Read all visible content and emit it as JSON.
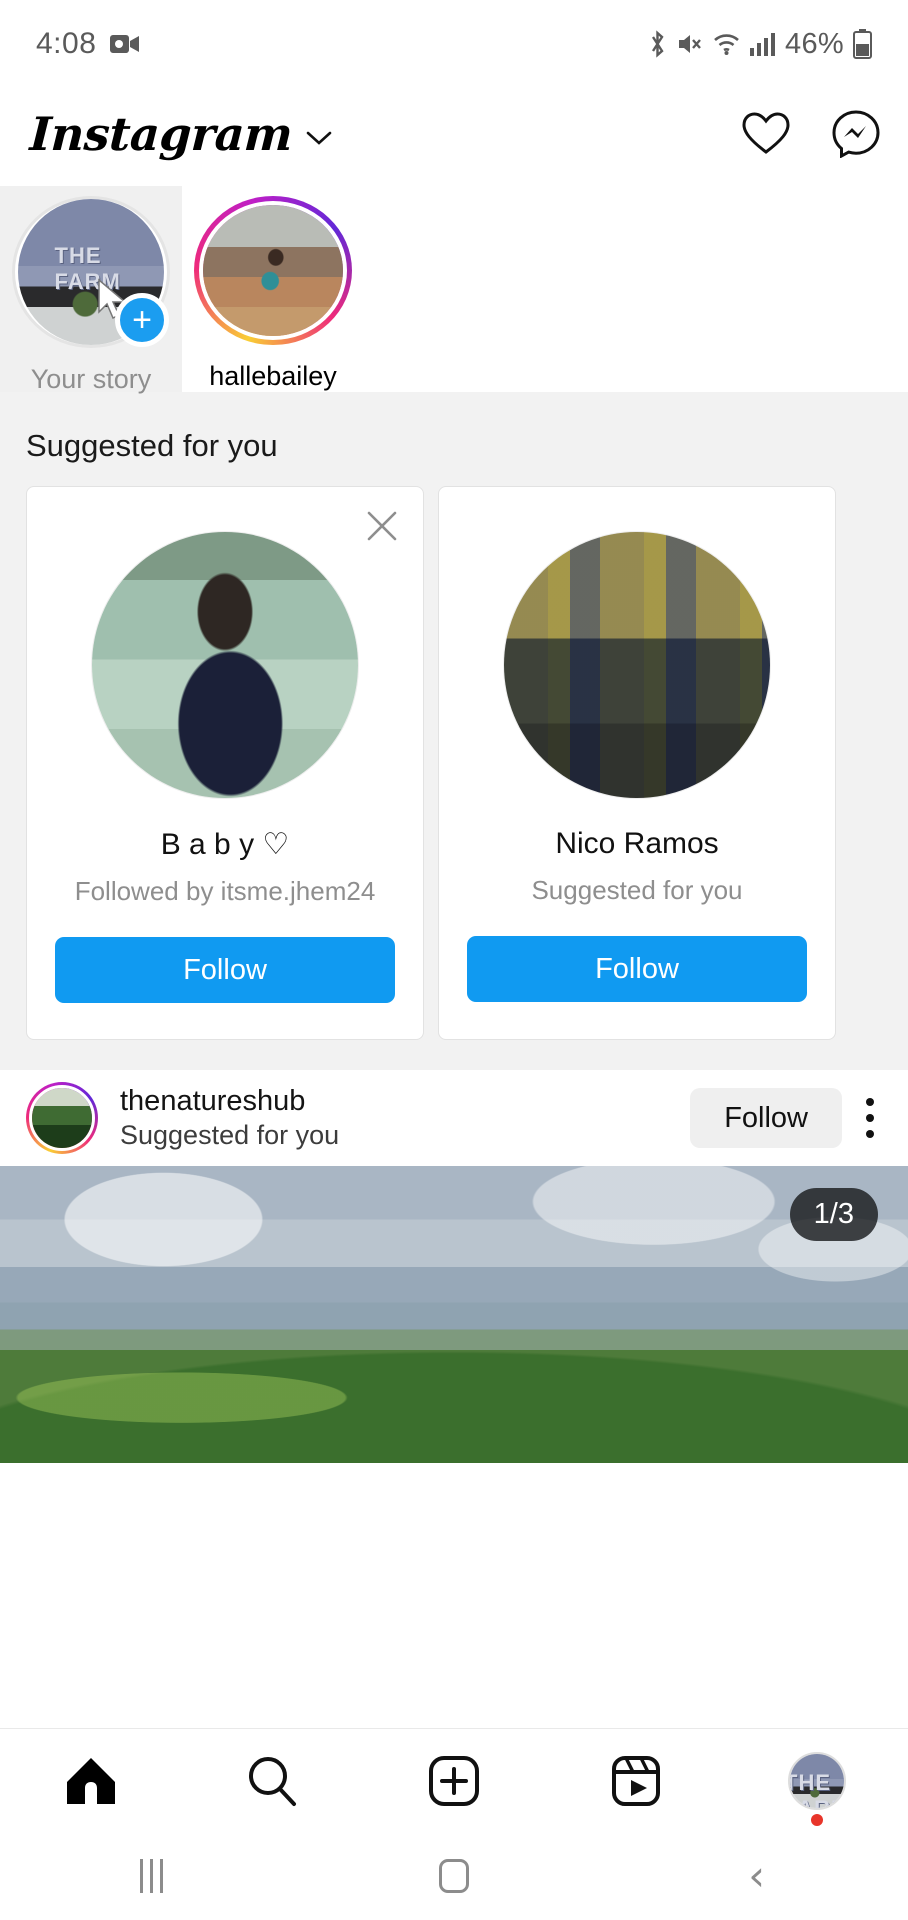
{
  "status_bar": {
    "time": "4:08",
    "battery_percent": "46%",
    "icons": [
      "video-recording-icon",
      "bluetooth-icon",
      "mute-icon",
      "wifi-icon",
      "cellular-signal-icon",
      "battery-icon"
    ]
  },
  "app_header": {
    "logo": "Instagram",
    "chevron": "chevron-down-icon",
    "actions": [
      "heart-icon",
      "messenger-icon"
    ]
  },
  "stories": {
    "items": [
      {
        "label": "Your story",
        "type": "own",
        "add_badge": "+"
      },
      {
        "label": "hallebailey",
        "type": "unseen"
      }
    ]
  },
  "suggested": {
    "title": "Suggested for you",
    "cards": [
      {
        "name": "B a b y ♡",
        "subtitle": "Followed by itsme.jhem24",
        "button": "Follow",
        "has_close": true
      },
      {
        "name": "Nico Ramos",
        "subtitle": "Suggested for you",
        "button": "Follow",
        "has_close": false
      }
    ]
  },
  "post": {
    "username": "thenatureshub",
    "subtitle": "Suggested for you",
    "follow_label": "Follow",
    "more_icon": "three-dots-vertical-icon",
    "carousel_counter": "1/3"
  },
  "tabbar": {
    "items": [
      {
        "name": "home-icon",
        "label": "Home",
        "active": true
      },
      {
        "name": "search-icon",
        "label": "Search",
        "active": false
      },
      {
        "name": "create-icon",
        "label": "Create",
        "active": false
      },
      {
        "name": "reels-icon",
        "label": "Reels",
        "active": false
      },
      {
        "name": "profile-avatar",
        "label": "Profile",
        "active": false
      }
    ]
  },
  "android_nav": {
    "recents": "recents-icon",
    "home": "home-button-icon",
    "back": "‹"
  },
  "colors": {
    "accent_blue": "#109af1",
    "gray_button": "#efefef",
    "section_bg": "#f2f2f2",
    "muted_text": "#8e8e8e",
    "badge_red": "#e8352a"
  }
}
